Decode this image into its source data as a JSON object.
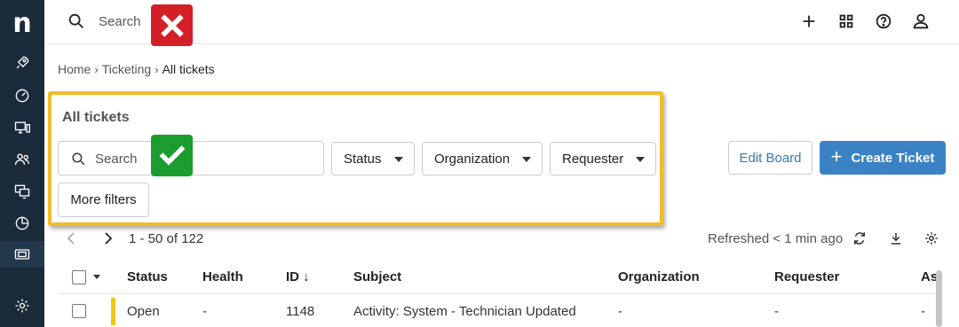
{
  "sidebar": {
    "logo": "n",
    "items": [
      {
        "icon": "rocket-icon"
      },
      {
        "icon": "dashboard-gauge-icon"
      },
      {
        "icon": "devices-icon"
      },
      {
        "icon": "users-icon"
      },
      {
        "icon": "monitors-icon"
      },
      {
        "icon": "reports-pie-icon"
      },
      {
        "icon": "ticket-icon",
        "active": true
      },
      {
        "icon": "settings-gear-icon"
      }
    ]
  },
  "topbar": {
    "search_label": "Search",
    "icons": [
      "search-icon",
      "close-icon",
      "plus-icon",
      "apps-grid-icon",
      "help-icon",
      "user-icon"
    ]
  },
  "breadcrumb": {
    "items": [
      "Home",
      "Ticketing",
      "All tickets"
    ]
  },
  "filters": {
    "title": "All tickets",
    "search_placeholder": "Search",
    "status_label": "Status",
    "organization_label": "Organization",
    "requester_label": "Requester",
    "more_filters_label": "More filters"
  },
  "actions": {
    "edit_board_label": "Edit Board",
    "create_ticket_label": "Create Ticket"
  },
  "pager": {
    "range_text": "1 - 50 of 122",
    "refreshed_text": "Refreshed < 1 min ago"
  },
  "table": {
    "columns": [
      "Status",
      "Health",
      "ID",
      "Subject",
      "Organization",
      "Requester",
      "As"
    ],
    "rows": [
      {
        "status": "Open",
        "health": "-",
        "id": "1148",
        "subject": "Activity: System - Technician Updated",
        "organization": "-",
        "requester": "-",
        "assignee": "-"
      }
    ]
  },
  "colors": {
    "sidebar_bg": "#1b2b3c",
    "highlight_border": "#f2bb2b",
    "primary_button": "#3b82c4",
    "link_text": "#337ab7",
    "wrong_marker": "#d41f26",
    "correct_marker": "#1a9d2e",
    "status_open": "#f2c811"
  }
}
